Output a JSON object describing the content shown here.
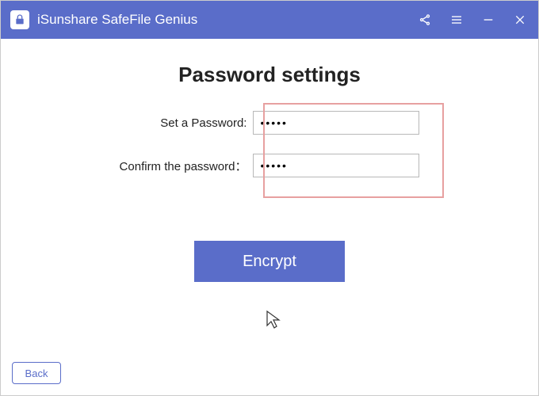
{
  "app": {
    "title": "iSunshare SafeFile Genius"
  },
  "page": {
    "heading": "Password settings"
  },
  "form": {
    "password_label": "Set a Password:",
    "password_value": "•••••",
    "confirm_label": "Confirm the password：",
    "confirm_value": "•••••"
  },
  "actions": {
    "encrypt": "Encrypt",
    "back": "Back"
  }
}
